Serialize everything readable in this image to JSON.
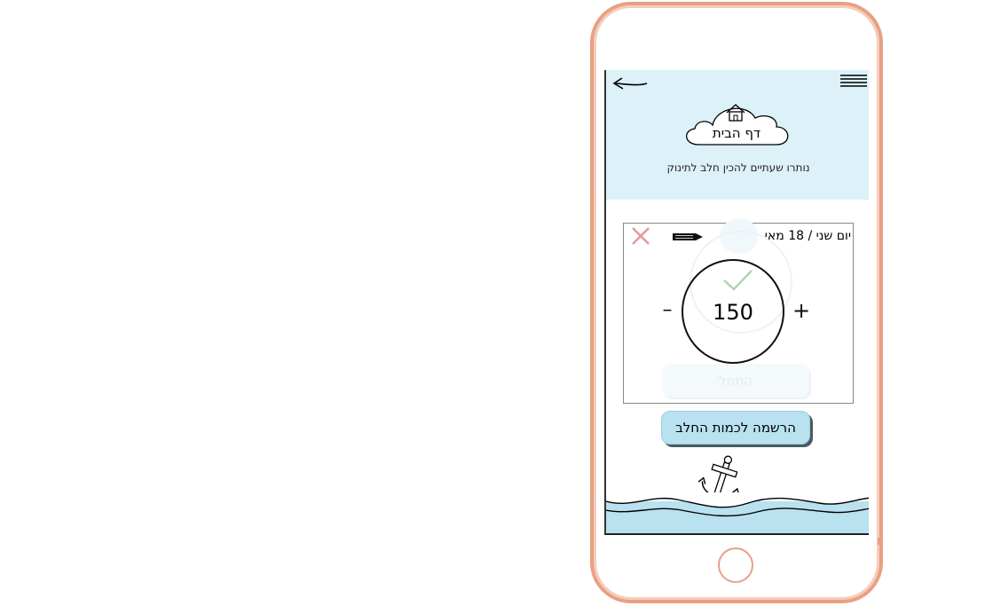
{
  "header": {
    "title": "דף הבית",
    "subtitle": "נותרו שעתיים להכין חלב לתינוק"
  },
  "icons": {
    "back": "back-arrow-icon",
    "menu": "hamburger-menu-icon",
    "home": "home-icon",
    "edit": "pencil-icon",
    "close": "close-icon",
    "check": "check-icon",
    "anchor": "anchor-icon"
  },
  "card": {
    "date": "יום שני / 18 מאי",
    "amount": "150",
    "minus_label": "–",
    "plus_label": "+",
    "start_label": "התחל"
  },
  "register_button": {
    "label": "הרשמה לכמות החלב"
  },
  "colors": {
    "header_bg": "#dcf1f8",
    "phone_frame": "#e8a084",
    "button_bg": "#b9e1f0",
    "close_red": "#e39a9a",
    "check_green": "#a8d8a8",
    "water": "#b9e1f0"
  }
}
